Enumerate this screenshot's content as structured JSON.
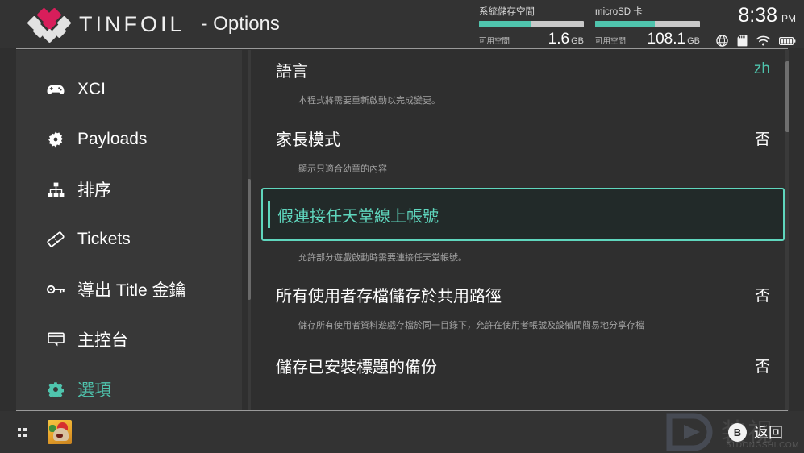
{
  "header": {
    "brand_name": "TINFOIL",
    "brand_sub": "- Options",
    "logo_icon": "tinfoil-diamond-logo"
  },
  "status": {
    "system_storage": {
      "label": "系統儲存空間",
      "free_label": "可用空間",
      "free_value": "1.6",
      "free_unit": "GB",
      "fill_percent": 50
    },
    "microsd": {
      "label": "microSD 卡",
      "free_label": "可用空間",
      "free_value": "108.1",
      "free_unit": "GB",
      "fill_percent": 57
    },
    "clock": {
      "time": "8:38",
      "ampm": "PM"
    },
    "tray_icons": [
      "globe-icon",
      "sd-card-icon",
      "wifi-icon",
      "battery-icon"
    ],
    "accent_color": "#4fc4ad"
  },
  "sidebar": {
    "items": [
      {
        "label": "XCI",
        "icon": "gamepad-icon",
        "active": false
      },
      {
        "label": "Payloads",
        "icon": "burst-gear-icon",
        "active": false
      },
      {
        "label": "排序",
        "icon": "sitemap-icon",
        "active": false
      },
      {
        "label": "Tickets",
        "icon": "ticket-icon",
        "active": false
      },
      {
        "label": "導出 Title 金鑰",
        "icon": "key-icon",
        "active": false
      },
      {
        "label": "主控台",
        "icon": "console-icon",
        "active": false
      },
      {
        "label": "選項",
        "icon": "gear-icon",
        "active": true
      }
    ]
  },
  "main": {
    "rows": [
      {
        "title": "語言",
        "value": "zh",
        "value_accent": true,
        "description": "本程式將需要重新啟動以完成變更。",
        "selected": false
      },
      {
        "title": "家長模式",
        "value": "否",
        "value_accent": false,
        "description": "顯示只適合幼童的內容",
        "selected": false
      },
      {
        "title": "假連接任天堂線上帳號",
        "value": "",
        "value_accent": false,
        "description": "允許部分遊戲啟動時需要連接任天堂帳號。",
        "selected": true
      },
      {
        "title": "所有使用者存檔儲存於共用路徑",
        "value": "否",
        "value_accent": false,
        "description": "儲存所有使用者資料遊戲存檔於同一目錄下，允許在使用者帳號及設備間簡易地分享存檔",
        "selected": false
      },
      {
        "title": "儲存已安裝標題的備份",
        "value": "否",
        "value_accent": false,
        "description": "",
        "selected": false
      }
    ]
  },
  "footer": {
    "apps_icon": "grid-apps-icon",
    "game_tile_icon": "game-thumbnail-icon",
    "back_button_key": "B",
    "back_button_label": "返回",
    "watermark_cjk": "装视",
    "watermark_text": "51DONGSHI.COM"
  }
}
